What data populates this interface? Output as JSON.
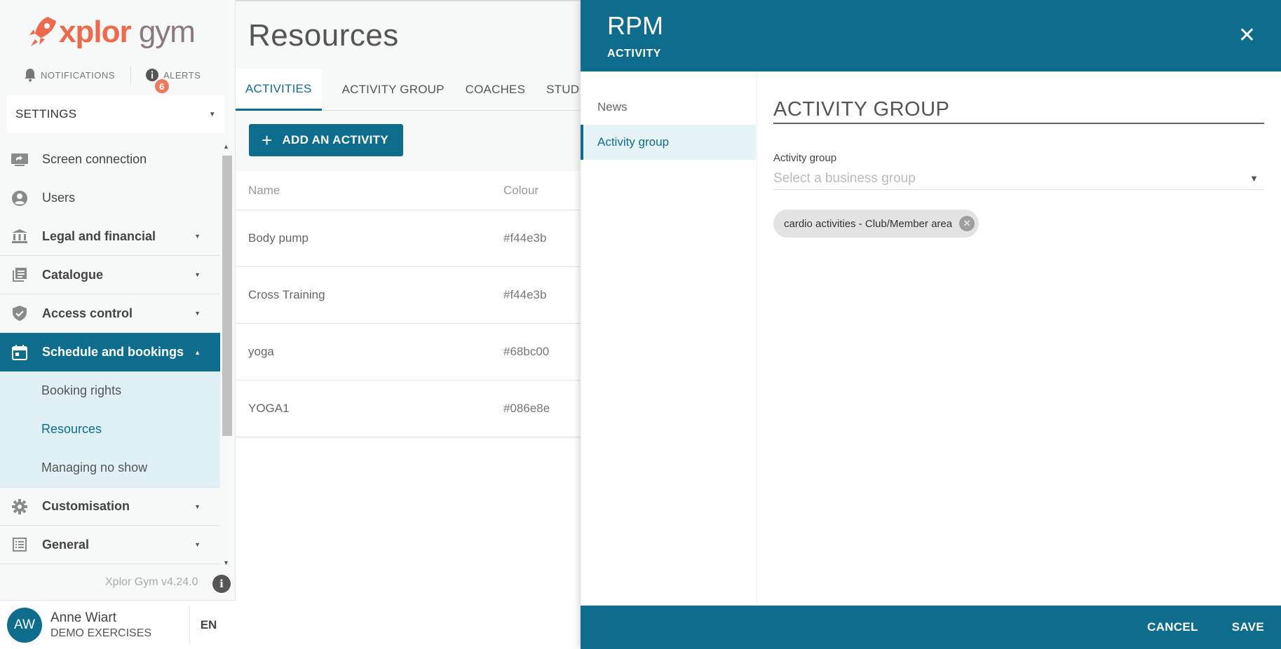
{
  "app": {
    "logo_text_x": "xplor",
    "logo_text_g": "gym",
    "notifications_label": "NOTIFICATIONS",
    "alerts_label": "ALERTS",
    "alerts_count": "6"
  },
  "sidebar": {
    "settings_label": "SETTINGS",
    "items": [
      {
        "label": "Screen connection",
        "icon": "screen-share-icon"
      },
      {
        "label": "Users",
        "icon": "user-circle-icon"
      },
      {
        "label": "Legal and financial",
        "icon": "bank-icon"
      },
      {
        "label": "Catalogue",
        "icon": "catalogue-icon"
      },
      {
        "label": "Access control",
        "icon": "shield-check-icon"
      },
      {
        "label": "Schedule and bookings",
        "icon": "calendar-icon"
      },
      {
        "label": "Customisation",
        "icon": "gear-icon"
      },
      {
        "label": "General",
        "icon": "list-icon"
      }
    ],
    "sub_items": [
      "Booking rights",
      "Resources",
      "Managing no show"
    ],
    "version": "Xplor Gym v4.24.0",
    "user": {
      "initials": "AW",
      "name": "Anne Wiart",
      "org": "DEMO EXERCISES",
      "lang": "EN"
    }
  },
  "main": {
    "title": "Resources",
    "tabs": [
      "ACTIVITIES",
      "ACTIVITY GROUP",
      "COACHES",
      "STUD"
    ],
    "add_button": "ADD AN ACTIVITY",
    "columns": [
      "Name",
      "Colour"
    ],
    "rows": [
      {
        "name": "Body pump",
        "colour": "#f44e3b"
      },
      {
        "name": "Cross Training",
        "colour": "#f44e3b"
      },
      {
        "name": "yoga",
        "colour": "#68bc00"
      },
      {
        "name": "YOGA1",
        "colour": "#086e8e"
      }
    ]
  },
  "panel": {
    "title": "RPM",
    "subtitle": "ACTIVITY",
    "close": "✕",
    "nav": [
      "News",
      "Activity group"
    ],
    "section_title": "ACTIVITY GROUP",
    "field_label": "Activity group",
    "field_placeholder": "Select a business group",
    "chip": "cardio activities - Club/Member area",
    "cancel": "CANCEL",
    "save": "SAVE"
  },
  "colors": {
    "primary": "#0e6d8c",
    "accent": "#ef6a4c",
    "badge": "#ef7b5f"
  }
}
